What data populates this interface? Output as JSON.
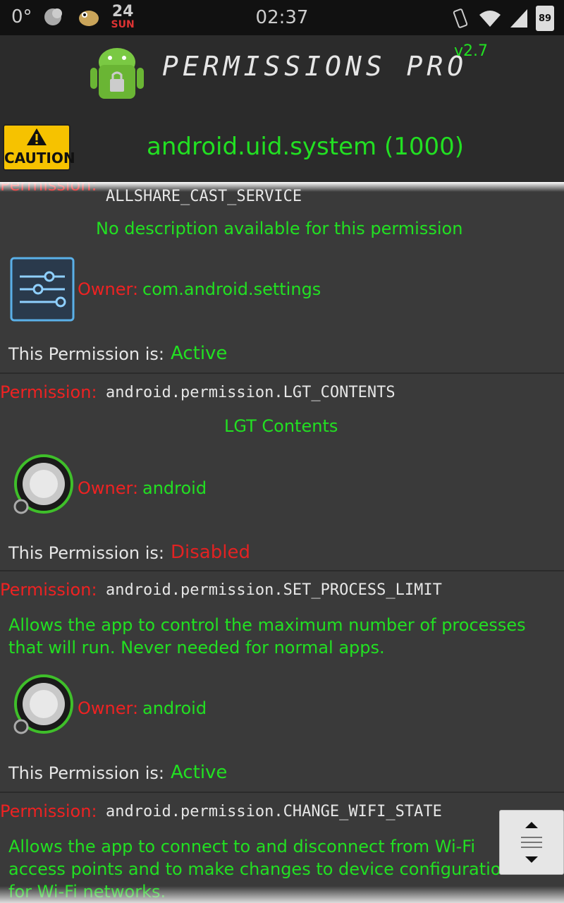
{
  "status_bar": {
    "temperature": "0°",
    "date_day": "24",
    "date_dow": "SUN",
    "time": "02:37",
    "battery": "89"
  },
  "header": {
    "app_title": "PERMISSIONS PRO",
    "version": "v2.7",
    "caution_label": "CAUTION",
    "uid_title": "android.uid.system (1000)"
  },
  "permissions": [
    {
      "label": "Permission:",
      "name": "ALLSHARE_CAST_SERVICE",
      "description": "No description available for this permission",
      "owner_label": "Owner:",
      "owner": "com.android.settings",
      "owner_icon": "settings-sliders-icon",
      "status_label": "This Permission is:",
      "status": "Active",
      "status_color": "#22e022"
    },
    {
      "label": "Permission:",
      "name": "android.permission.LGT_CONTENTS",
      "description": "LGT Contents",
      "owner_label": "Owner:",
      "owner": "android",
      "owner_icon": "android-system-icon",
      "status_label": "This Permission is:",
      "status": "Disabled",
      "status_color": "#e22222"
    },
    {
      "label": "Permission:",
      "name": "android.permission.SET_PROCESS_LIMIT",
      "description_line1": "Allows the app to control the maximum number of processes",
      "description_line2": "that will run. Never needed for normal apps.",
      "owner_label": "Owner:",
      "owner": "android",
      "owner_icon": "android-system-icon",
      "status_label": "This Permission is:",
      "status": "Active",
      "status_color": "#22e022"
    },
    {
      "label": "Permission:",
      "name": "android.permission.CHANGE_WIFI_STATE",
      "description_line1": "Allows the app to connect to and disconnect from Wi-Fi",
      "description_line2": "access points and to make changes to device configuration",
      "description_line3": "for Wi-Fi networks."
    }
  ],
  "colors": {
    "accent_green": "#22e022",
    "label_red": "#e22222"
  }
}
